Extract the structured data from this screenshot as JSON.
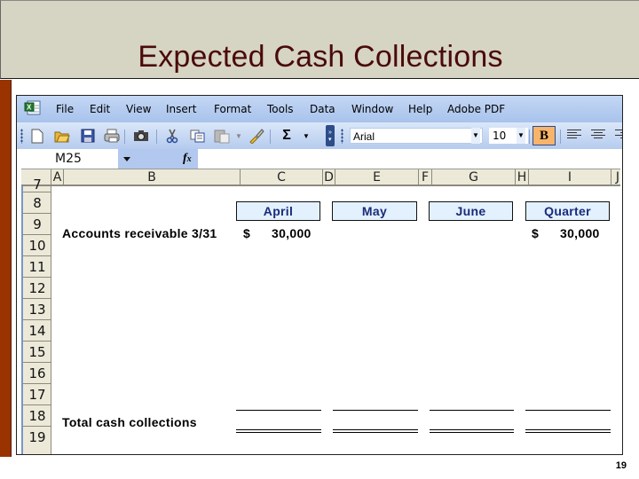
{
  "slide": {
    "title": "Expected Cash Collections",
    "page_number": "19",
    "accent_color": "#993300"
  },
  "menubar": {
    "items": [
      {
        "label": "File"
      },
      {
        "label": "Edit"
      },
      {
        "label": "View"
      },
      {
        "label": "Insert"
      },
      {
        "label": "Format"
      },
      {
        "label": "Tools"
      },
      {
        "label": "Data"
      },
      {
        "label": "Window"
      },
      {
        "label": "Help"
      },
      {
        "label": "Adobe PDF"
      }
    ]
  },
  "toolbar": {
    "icons": [
      "new-icon",
      "open-icon",
      "save-icon",
      "print-icon",
      "camera-icon",
      "cut-icon",
      "copy-icon",
      "paste-icon",
      "format-painter-icon",
      "autosum-icon"
    ],
    "sigma_label": "Σ",
    "font_name": "Arial",
    "font_size": "10",
    "bold_label": "B",
    "bold_active": true
  },
  "formula_bar": {
    "name_box": "M25",
    "fx_label": "fx",
    "formula": ""
  },
  "sheet": {
    "columns": [
      "A",
      "B",
      "C",
      "D",
      "E",
      "F",
      "G",
      "H",
      "I",
      "J"
    ],
    "rows": [
      "7",
      "8",
      "9",
      "10",
      "11",
      "12",
      "13",
      "14",
      "15",
      "16",
      "17",
      "18",
      "19"
    ],
    "month_headers": [
      "April",
      "May",
      "June",
      "Quarter"
    ],
    "ar_label": "Accounts receivable 3/31",
    "ar_currency_c": "$",
    "ar_value_c": "30,000",
    "ar_currency_i": "$",
    "ar_value_i": "30,000",
    "total_label": "Total cash collections"
  }
}
